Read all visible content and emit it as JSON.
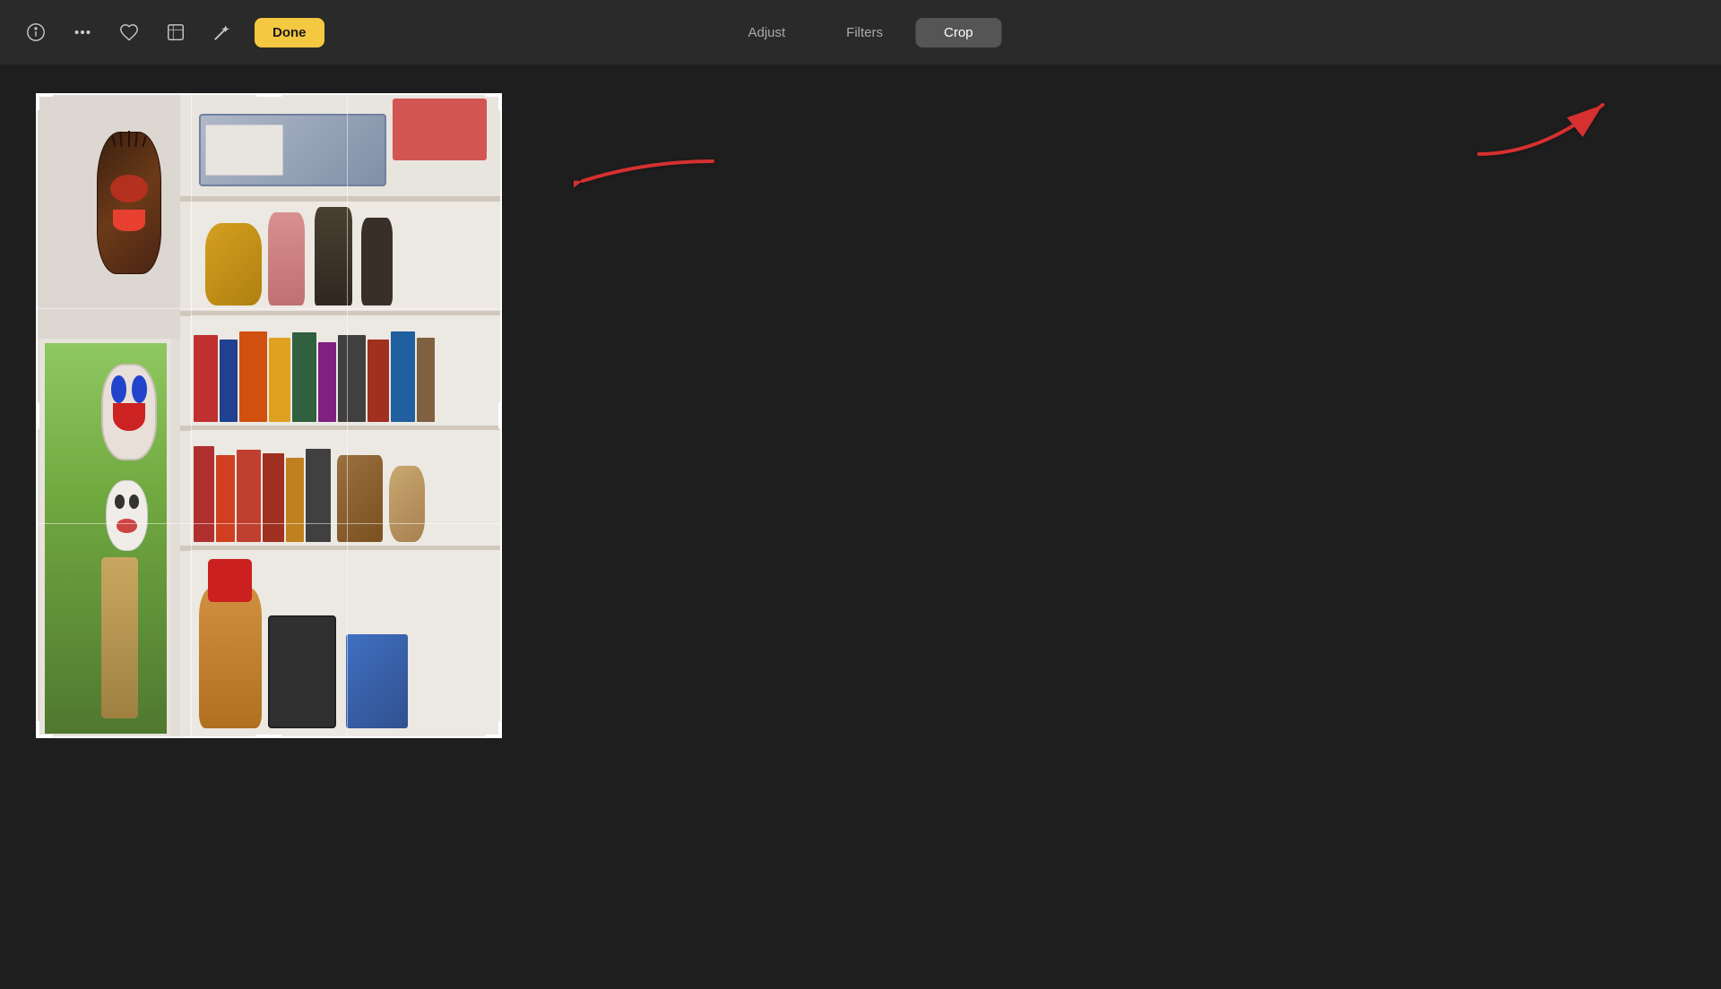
{
  "toolbar": {
    "tabs": [
      {
        "id": "adjust",
        "label": "Adjust",
        "active": false
      },
      {
        "id": "filters",
        "label": "Filters",
        "active": false
      },
      {
        "id": "crop",
        "label": "Crop",
        "active": true
      }
    ],
    "done_button_label": "Done",
    "icons": {
      "info": "ℹ",
      "more": "···",
      "heart": "♡",
      "aspect": "⊡",
      "magic": "✦"
    }
  },
  "arrows": {
    "left": {
      "label": "arrow pointing left toward crop handle"
    },
    "right": {
      "label": "arrow pointing right toward done button"
    }
  },
  "photo": {
    "alt": "Bookshelf with decorative masks and figurines"
  },
  "colors": {
    "background": "#1e1e1e",
    "toolbar": "#2a2a2a",
    "tab_active_bg": "#555555",
    "tab_active_text": "#ffffff",
    "tab_inactive_text": "#aaaaaa",
    "done_button_bg": "#f5c842",
    "done_button_text": "#1a1a1a",
    "icon_color": "#cccccc",
    "crop_border": "rgba(255,255,255,0.9)",
    "arrow_red": "#d63030"
  }
}
